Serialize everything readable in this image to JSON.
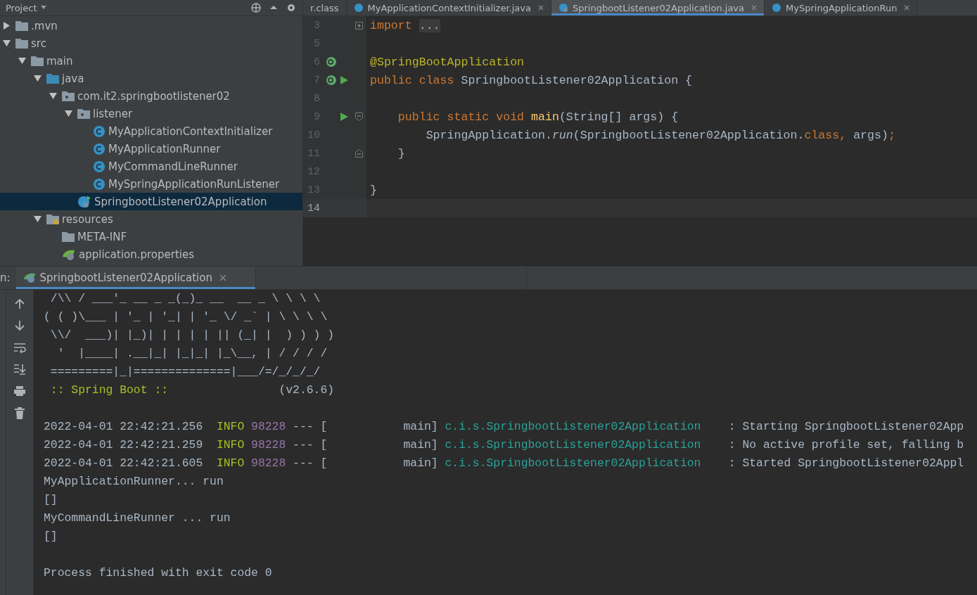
{
  "project_panel": {
    "title": "Project",
    "tree": [
      {
        "label": ".mvn",
        "kind": "folder",
        "expanded": false,
        "selected": false
      },
      {
        "label": "src",
        "kind": "folder",
        "expanded": true,
        "selected": false,
        "children": [
          {
            "label": "main",
            "kind": "folder",
            "expanded": true,
            "selected": false,
            "children": [
              {
                "label": "java",
                "kind": "source-folder",
                "expanded": true,
                "selected": false,
                "children": [
                  {
                    "label": "com.it2.springbootlistener02",
                    "kind": "package",
                    "expanded": true,
                    "selected": false,
                    "children": [
                      {
                        "label": "listener",
                        "kind": "package",
                        "expanded": true,
                        "selected": false,
                        "children": [
                          {
                            "label": "MyApplicationContextInitializer",
                            "kind": "class",
                            "selected": false
                          },
                          {
                            "label": "MyApplicationRunner",
                            "kind": "class",
                            "selected": false
                          },
                          {
                            "label": "MyCommandLineRunner",
                            "kind": "class",
                            "selected": false
                          },
                          {
                            "label": "MySpringApplicationRunListener",
                            "kind": "class",
                            "selected": false
                          }
                        ]
                      },
                      {
                        "label": "SpringbootListener02Application",
                        "kind": "spring-class",
                        "selected": true
                      }
                    ]
                  }
                ]
              },
              {
                "label": "resources",
                "kind": "resources-folder",
                "expanded": true,
                "selected": false,
                "children": [
                  {
                    "label": "META-INF",
                    "kind": "folder",
                    "selected": false
                  },
                  {
                    "label": "application.properties",
                    "kind": "spring-file",
                    "selected": false
                  }
                ]
              }
            ]
          }
        ]
      }
    ]
  },
  "editor": {
    "tabs": [
      {
        "label": "r.class",
        "kind": "file",
        "selected": false
      },
      {
        "label": "MyApplicationContextInitializer.java",
        "kind": "class",
        "selected": false
      },
      {
        "label": "SpringbootListener02Application.java",
        "kind": "spring-class",
        "selected": true
      },
      {
        "label": "MySpringApplicationRun",
        "kind": "class",
        "selected": false
      }
    ],
    "lines": [
      {
        "number": "3",
        "current": false,
        "bean": false,
        "run": false,
        "folded": true,
        "fold_start": false,
        "fold_end": false,
        "tokens": [
          {
            "text": "import",
            "kind": "keyword"
          },
          {
            "text": "...",
            "kind": "folded"
          }
        ]
      },
      {
        "number": "5",
        "current": false,
        "bean": false,
        "run": false,
        "folded": false,
        "fold_start": false,
        "fold_end": false
      },
      {
        "number": "6",
        "current": false,
        "bean": true,
        "run": false,
        "folded": false,
        "fold_start": false,
        "fold_end": false,
        "tokens": [
          {
            "text": "@SpringBootApplication",
            "kind": "annotation"
          }
        ]
      },
      {
        "number": "7",
        "current": false,
        "bean": true,
        "run": true,
        "folded": false,
        "fold_start": false,
        "fold_end": false,
        "tokens": [
          {
            "text": "public class ",
            "kind": "keyword"
          },
          {
            "text": "SpringbootListener02Application {",
            "kind": "plain"
          }
        ]
      },
      {
        "number": "8",
        "current": false,
        "bean": false,
        "run": false,
        "folded": false,
        "fold_start": false,
        "fold_end": false
      },
      {
        "number": "9",
        "current": false,
        "bean": false,
        "run": true,
        "folded": false,
        "fold_start": true,
        "fold_end": false,
        "tokens": [
          {
            "text": "    public static void ",
            "kind": "keyword"
          },
          {
            "text": "main",
            "kind": "method"
          },
          {
            "text": "(String[] args) {",
            "kind": "plain"
          }
        ]
      },
      {
        "number": "10",
        "current": false,
        "bean": false,
        "run": false,
        "folded": false,
        "fold_start": false,
        "fold_end": false,
        "tokens": [
          {
            "text": "        SpringApplication.",
            "kind": "plain"
          },
          {
            "text": "run",
            "kind": "italic"
          },
          {
            "text": "(SpringbootListener02Application.",
            "kind": "plain"
          },
          {
            "text": "class, ",
            "kind": "keyword"
          },
          {
            "text": "args)",
            "kind": "plain"
          },
          {
            "text": ";",
            "kind": "keyword"
          }
        ]
      },
      {
        "number": "11",
        "current": false,
        "bean": false,
        "run": false,
        "folded": false,
        "fold_start": false,
        "fold_end": true,
        "tokens": [
          {
            "text": "    }",
            "kind": "plain"
          }
        ]
      },
      {
        "number": "12",
        "current": false,
        "bean": false,
        "run": false,
        "folded": false,
        "fold_start": false,
        "fold_end": false
      },
      {
        "number": "13",
        "current": false,
        "bean": false,
        "run": false,
        "folded": false,
        "fold_start": false,
        "fold_end": false,
        "tokens": [
          {
            "text": "}",
            "kind": "plain"
          }
        ]
      },
      {
        "number": "14",
        "current": true,
        "bean": false,
        "run": false,
        "folded": false,
        "fold_start": false,
        "fold_end": false
      }
    ]
  },
  "run_panel": {
    "prefix": "n:",
    "tab": {
      "label": "SpringbootListener02Application",
      "selected": true
    },
    "lines": [
      {
        "kind": "banner",
        "text": " /\\\\ / ___'_ __ _ _(_)_ __  __ _ \\ \\ \\ \\"
      },
      {
        "kind": "banner",
        "text": "( ( )\\___ | '_ | '_| | '_ \\/ _` | \\ \\ \\ \\"
      },
      {
        "kind": "banner",
        "text": " \\\\/  ___)| |_)| | | | | || (_| |  ) ) ) )"
      },
      {
        "kind": "banner",
        "text": "  '  |____| .__|_| |_|_| |_\\__, | / / / /"
      },
      {
        "kind": "banner",
        "text": " =========|_|==============|___/=/_/_/_/"
      },
      {
        "kind": "version",
        "label": " :: Spring Boot ::",
        "version": "(v2.6.6)"
      },
      {
        "kind": "blank"
      },
      {
        "kind": "log",
        "time": "2022-04-01 22:42:21.256",
        "level": "INFO",
        "pid": "98228",
        "thread": "--- [           main]",
        "logger": "c.i.s.SpringbootListener02Application",
        "message": ": Starting SpringbootListener02App"
      },
      {
        "kind": "log",
        "time": "2022-04-01 22:42:21.259",
        "level": "INFO",
        "pid": "98228",
        "thread": "--- [           main]",
        "logger": "c.i.s.SpringbootListener02Application",
        "message": ": No active profile set, falling b"
      },
      {
        "kind": "log",
        "time": "2022-04-01 22:42:21.605",
        "level": "INFO",
        "pid": "98228",
        "thread": "--- [           main]",
        "logger": "c.i.s.SpringbootListener02Application",
        "message": ": Started SpringbootListener02Appl"
      },
      {
        "kind": "plain",
        "text": "MyApplicationRunner... run"
      },
      {
        "kind": "plain",
        "text": "[]"
      },
      {
        "kind": "plain",
        "text": "MyCommandLineRunner ... run"
      },
      {
        "kind": "plain",
        "text": "[]"
      },
      {
        "kind": "blank"
      },
      {
        "kind": "plain",
        "text": "Process finished with exit code 0"
      }
    ]
  }
}
